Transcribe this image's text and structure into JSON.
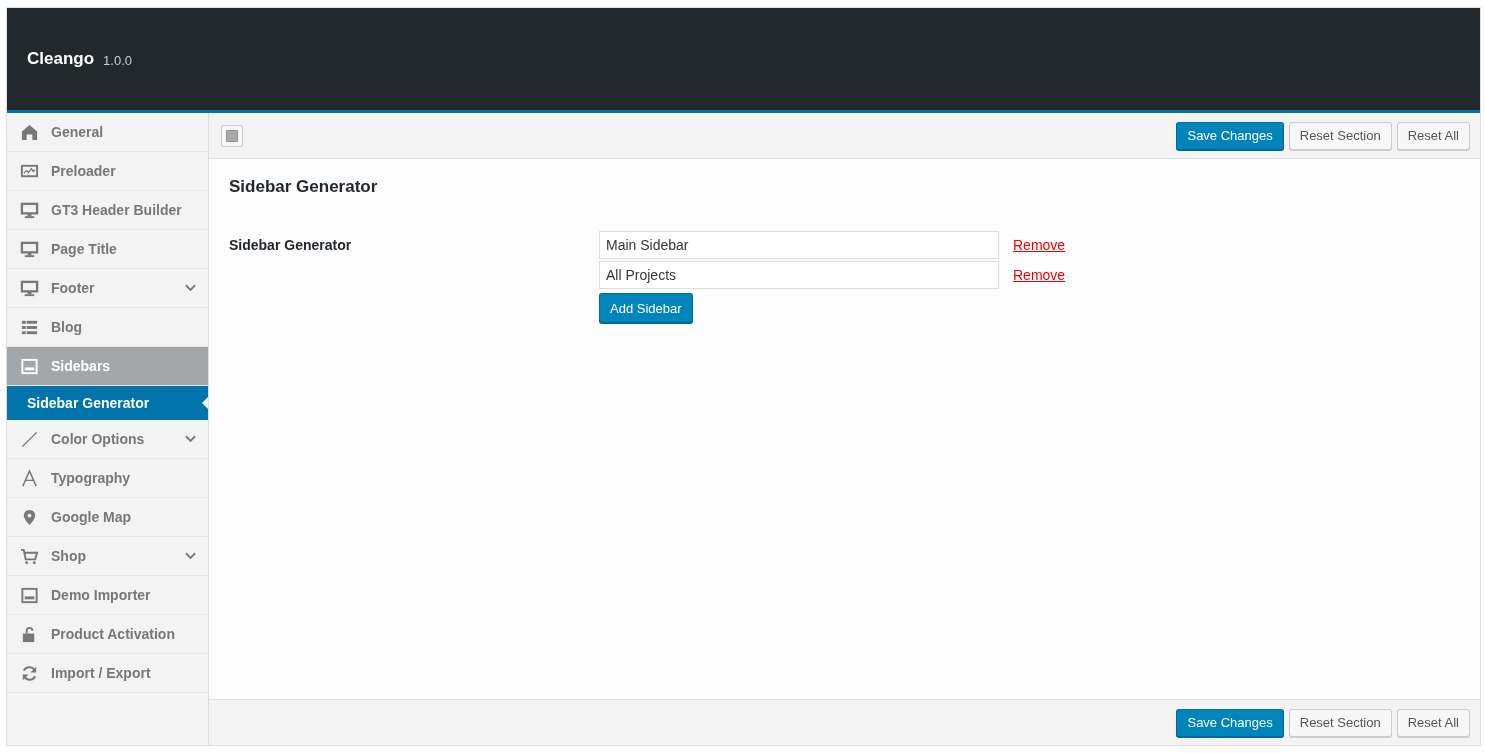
{
  "header": {
    "title": "Cleango",
    "version": "1.0.0"
  },
  "sidebar": {
    "items": [
      {
        "label": "General",
        "selected": false,
        "collapsible": false
      },
      {
        "label": "Preloader",
        "selected": false,
        "collapsible": false
      },
      {
        "label": "GT3 Header Builder",
        "selected": false,
        "collapsible": false
      },
      {
        "label": "Page Title",
        "selected": false,
        "collapsible": false
      },
      {
        "label": "Footer",
        "selected": false,
        "collapsible": true
      },
      {
        "label": "Blog",
        "selected": false,
        "collapsible": false
      },
      {
        "label": "Sidebars",
        "selected": true,
        "collapsible": false,
        "children": [
          {
            "label": "Sidebar Generator",
            "selected": true
          }
        ]
      },
      {
        "label": "Color Options",
        "selected": false,
        "collapsible": true
      },
      {
        "label": "Typography",
        "selected": false,
        "collapsible": false
      },
      {
        "label": "Google Map",
        "selected": false,
        "collapsible": false
      },
      {
        "label": "Shop",
        "selected": false,
        "collapsible": true
      },
      {
        "label": "Demo Importer",
        "selected": false,
        "collapsible": false
      },
      {
        "label": "Product Activation",
        "selected": false,
        "collapsible": false
      },
      {
        "label": "Import / Export",
        "selected": false,
        "collapsible": false
      }
    ]
  },
  "top_actions": [
    "Save Changes",
    "Reset Section",
    "Reset All"
  ],
  "section": {
    "title": "Sidebar Generator",
    "field_label": "Sidebar Generator",
    "sidebars": [
      {
        "value": "Main Sidebar",
        "remove": "Remove"
      },
      {
        "value": "All Projects",
        "remove": "Remove"
      }
    ],
    "add_button": "Add Sidebar"
  },
  "bottom_actions": [
    "Save Changes",
    "Reset Section",
    "Reset All"
  ]
}
